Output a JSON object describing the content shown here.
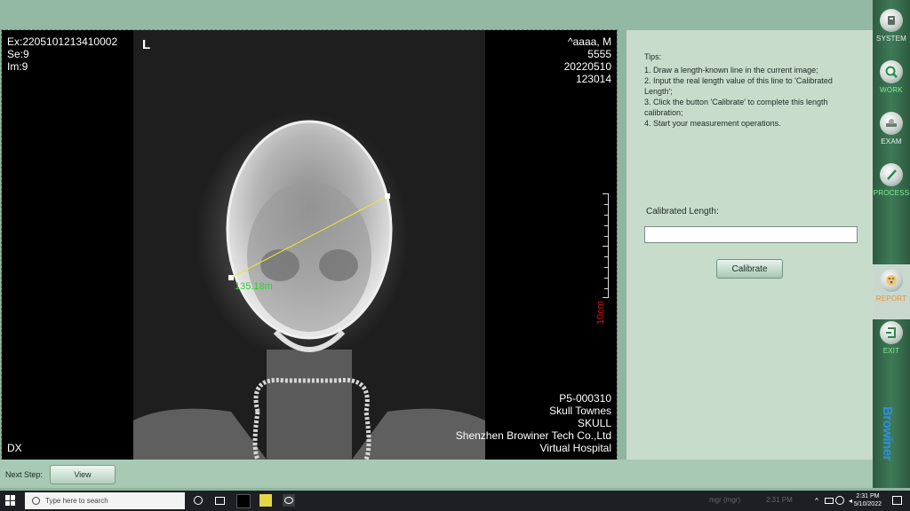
{
  "viewer": {
    "top_left": [
      "Ex:2205101213410002",
      "Se:9",
      "Im:9"
    ],
    "top_right": [
      "^aaaa, M",
      "5555",
      "20220510",
      "123014"
    ],
    "bottom_right": [
      "P5-000310",
      "Skull Townes",
      "SKULL",
      "Shenzhen Browiner Tech Co.,Ltd",
      "Virtual Hospital"
    ],
    "bottom_left": "DX",
    "orientation": "L",
    "measurement": "135.18m",
    "scale_label": "10cm"
  },
  "panel": {
    "tips_title": "Tips:",
    "tips": [
      "1. Draw a length-known line in the current image;",
      " 2. Input the real length value of this line to 'Calibrated Length';",
      " 3. Click the button 'Calibrate' to complete this length calibration;",
      " 4. Start your measurement operations."
    ],
    "calibrated_length_label": "Calibrated Length:",
    "calibrated_length_value": "",
    "calibrate_button": "Calibrate"
  },
  "sidebar": {
    "items": [
      {
        "label": "SYSTEM",
        "icon": "wrench-icon"
      },
      {
        "label": "WORK",
        "icon": "search-icon"
      },
      {
        "label": "EXAM",
        "icon": "scanner-icon"
      },
      {
        "label": "PROCESS",
        "icon": "pen-icon"
      },
      {
        "label": "REPORT",
        "icon": "palette-icon"
      },
      {
        "label": "EXIT",
        "icon": "exit-icon"
      }
    ],
    "brand": "Browiner"
  },
  "footer": {
    "next_step_label": "Next Step:",
    "view_button": "View"
  },
  "taskbar": {
    "search_placeholder": "Type here to search",
    "time": "2:31 PM",
    "date": "5/10/2022",
    "ghost_text": "mgr (mgr)",
    "ghost_time": "2:31 PM"
  },
  "colors": {
    "accent_green": "#7cf28a",
    "active_orange": "#f0902a",
    "scale_red": "#dd1111",
    "measure_line": "#e8e83a",
    "measure_text": "#2fd12f",
    "brand_blue": "#2c8fe0"
  }
}
